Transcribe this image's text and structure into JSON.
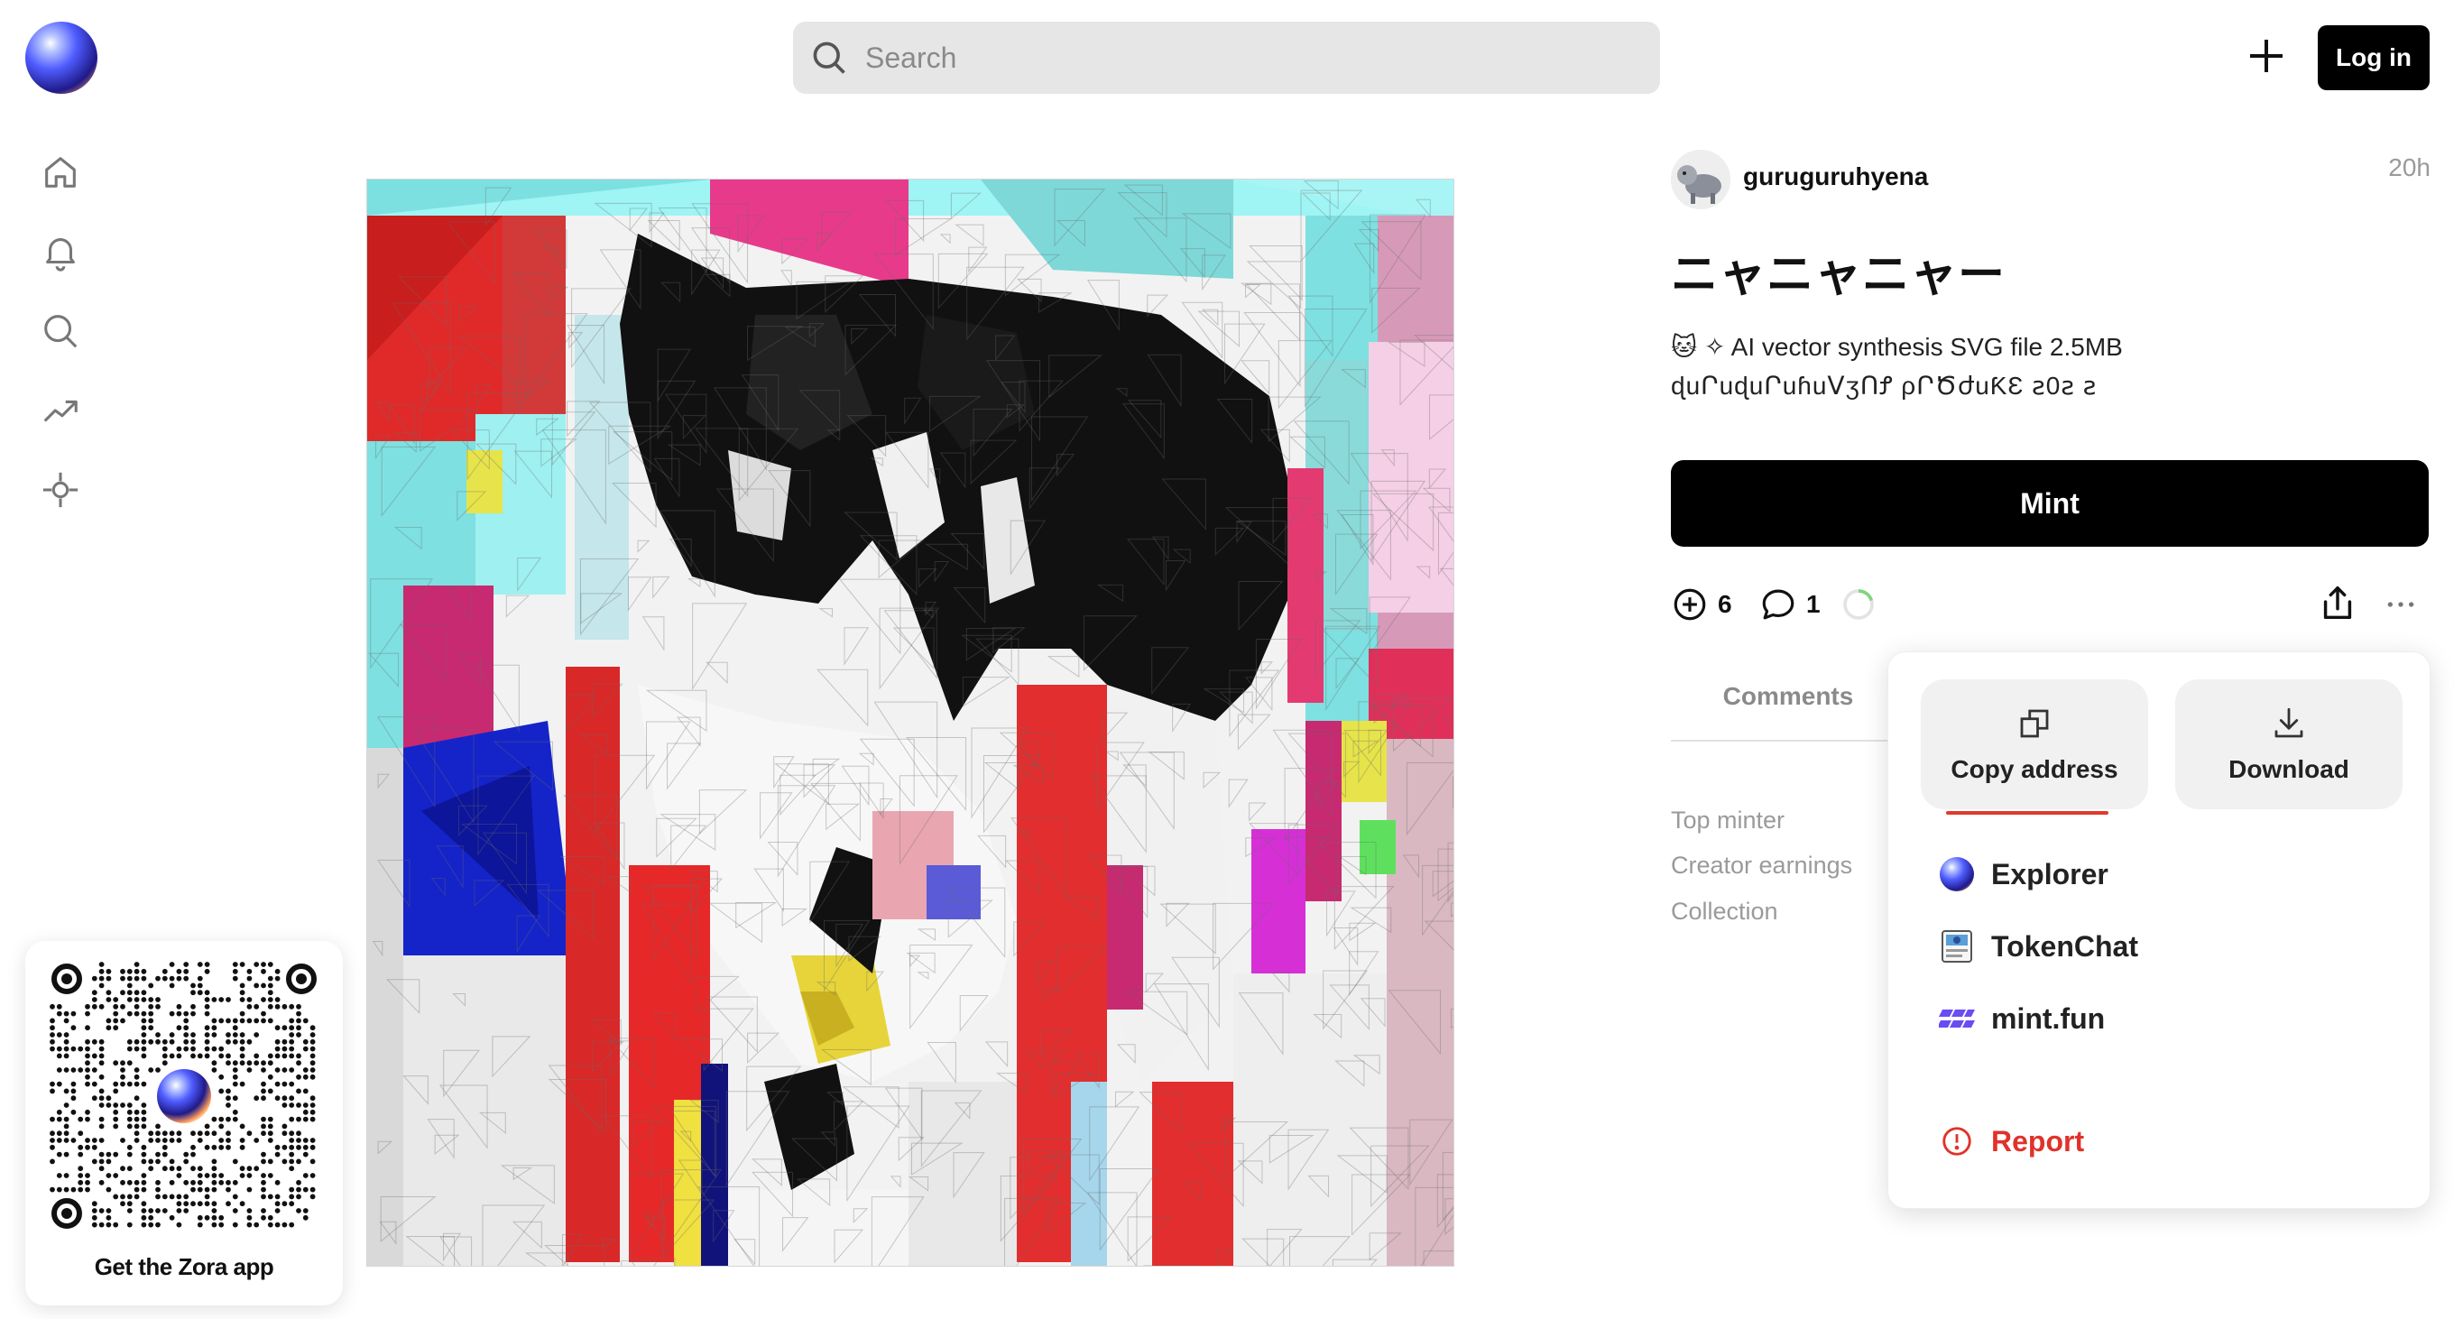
{
  "header": {
    "search_placeholder": "Search",
    "login_label": "Log in"
  },
  "sidebar": {
    "items": [
      {
        "name": "home",
        "icon": "home-icon"
      },
      {
        "name": "notifications",
        "icon": "bell-icon"
      },
      {
        "name": "search",
        "icon": "search-icon"
      },
      {
        "name": "trending",
        "icon": "trending-icon"
      },
      {
        "name": "explore",
        "icon": "crosshair-icon"
      }
    ]
  },
  "promo": {
    "label": "Get the Zora app"
  },
  "post": {
    "username": "guruguruhyena",
    "time": "20h",
    "title": "ニャニャニャー",
    "description_line1": "🐱 ✧ AI vector synthesis SVG file 2.5MB",
    "description_line2": "ɖuՐuɖuՐuɦuꓦʒՈꝬ ρՐԾժuƘƐ ꙅ0ꙅ ꙅ",
    "mint_label": "Mint",
    "mints_count": "6",
    "comments_count": "1"
  },
  "tabs": {
    "comments": "Comments"
  },
  "info_rows": [
    "Top minter",
    "Creator earnings",
    "Collection"
  ],
  "menu": {
    "copy_address": "Copy address",
    "download": "Download",
    "items": [
      "Explorer",
      "TokenChat",
      "mint.fun"
    ],
    "report": "Report"
  },
  "colors": {
    "accent_red": "#e0322a",
    "mintfun_purple": "#6b4cf0"
  }
}
